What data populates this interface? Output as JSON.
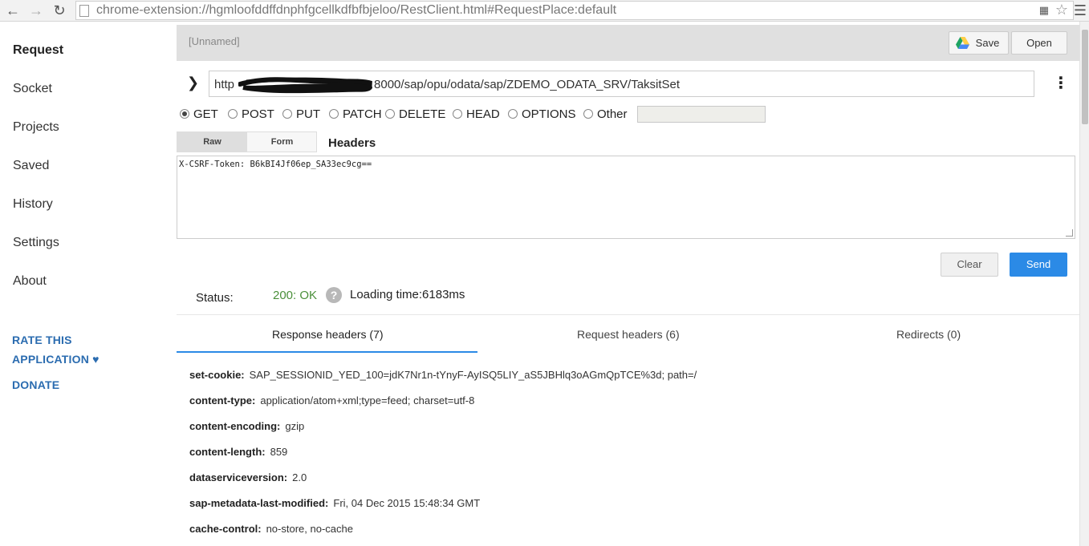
{
  "browser": {
    "url": "chrome-extension://hgmloofddffdnphfgcellkdfbfbjeloo/RestClient.html#RequestPlace:default"
  },
  "sidebar": {
    "items": [
      {
        "label": "Request"
      },
      {
        "label": "Socket"
      },
      {
        "label": "Projects"
      },
      {
        "label": "Saved"
      },
      {
        "label": "History"
      },
      {
        "label": "Settings"
      },
      {
        "label": "About"
      }
    ],
    "rate_line1": "RATE THIS",
    "rate_line2": "APPLICATION ♥",
    "donate": "DONATE"
  },
  "request": {
    "name_placeholder": "[Unnamed]",
    "save_label": "Save",
    "open_label": "Open",
    "url_prefix": "http",
    "url_suffix": "8000/sap/opu/odata/sap/ZDEMO_ODATA_SRV/TaksitSet",
    "methods": [
      "GET",
      "POST",
      "PUT",
      "PATCH",
      "DELETE",
      "HEAD",
      "OPTIONS",
      "Other"
    ],
    "selected_method": "GET",
    "tabs": {
      "raw": "Raw",
      "form": "Form"
    },
    "headers_label": "Headers",
    "headers_text": "X-CSRF-Token: B6kBI4Jf06ep_SA33ec9cg==",
    "clear_label": "Clear",
    "send_label": "Send"
  },
  "response": {
    "status_label": "Status:",
    "status_value": "200: OK",
    "help_glyph": "?",
    "loading_time": "Loading time:6183ms",
    "tabs": [
      {
        "label": "Response headers (7)"
      },
      {
        "label": "Request headers (6)"
      },
      {
        "label": "Redirects (0)"
      }
    ],
    "headers": [
      {
        "key": "set-cookie:",
        "value": "SAP_SESSIONID_YED_100=jdK7Nr1n-tYnyF-AyISQ5LIY_aS5JBHlq3oAGmQpTCE%3d; path=/"
      },
      {
        "key": "content-type:",
        "value": "application/atom+xml;type=feed; charset=utf-8"
      },
      {
        "key": "content-encoding:",
        "value": "gzip"
      },
      {
        "key": "content-length:",
        "value": "859"
      },
      {
        "key": "dataserviceversion:",
        "value": "2.0"
      },
      {
        "key": "sap-metadata-last-modified:",
        "value": "Fri, 04 Dec 2015 15:48:34 GMT"
      },
      {
        "key": "cache-control:",
        "value": "no-store, no-cache"
      }
    ]
  }
}
